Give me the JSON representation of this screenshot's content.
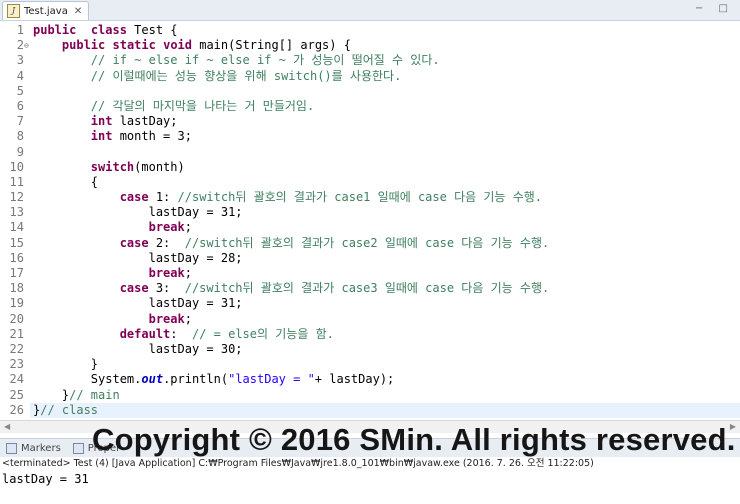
{
  "tab": {
    "label": "Test.java",
    "close": "✕"
  },
  "window_buttons": "− □",
  "code_lines": [
    {
      "n": "1",
      "parts": [
        [
          "kw",
          "public"
        ],
        [
          "",
          "  "
        ],
        [
          "kw",
          "class"
        ],
        [
          "",
          " Test {"
        ]
      ]
    },
    {
      "n": "2",
      "fold": "⊖",
      "parts": [
        [
          "",
          "    "
        ],
        [
          "kw",
          "public"
        ],
        [
          "",
          " "
        ],
        [
          "kw",
          "static"
        ],
        [
          "",
          " "
        ],
        [
          "kw",
          "void"
        ],
        [
          "",
          " main(String[] args) {"
        ]
      ]
    },
    {
      "n": "3",
      "parts": [
        [
          "",
          "        "
        ],
        [
          "cm",
          "// if ~ else if ~ else if ~ 가 성능이 떨어질 수 있다."
        ]
      ]
    },
    {
      "n": "4",
      "parts": [
        [
          "",
          "        "
        ],
        [
          "cm",
          "// 이럴때에는 성능 향상을 위해 switch()를 사용한다."
        ]
      ]
    },
    {
      "n": "5",
      "parts": []
    },
    {
      "n": "6",
      "parts": [
        [
          "",
          "        "
        ],
        [
          "cm",
          "// 각달의 마지막을 나타는 거 만들거임."
        ]
      ]
    },
    {
      "n": "7",
      "parts": [
        [
          "",
          "        "
        ],
        [
          "kw",
          "int"
        ],
        [
          "",
          " lastDay;"
        ]
      ]
    },
    {
      "n": "8",
      "parts": [
        [
          "",
          "        "
        ],
        [
          "kw",
          "int"
        ],
        [
          "",
          " month = 3;"
        ]
      ]
    },
    {
      "n": "9",
      "parts": []
    },
    {
      "n": "10",
      "parts": [
        [
          "",
          "        "
        ],
        [
          "kw",
          "switch"
        ],
        [
          "",
          "(month)"
        ]
      ]
    },
    {
      "n": "11",
      "parts": [
        [
          "",
          "        {"
        ]
      ]
    },
    {
      "n": "12",
      "parts": [
        [
          "",
          "            "
        ],
        [
          "kw",
          "case"
        ],
        [
          "",
          " 1: "
        ],
        [
          "cm",
          "//switch뒤 괄호의 결과가 case1 일때에 case 다음 기능 수행."
        ]
      ]
    },
    {
      "n": "13",
      "parts": [
        [
          "",
          "                lastDay = 31;"
        ]
      ]
    },
    {
      "n": "14",
      "parts": [
        [
          "",
          "                "
        ],
        [
          "kw",
          "break"
        ],
        [
          "",
          ";"
        ]
      ]
    },
    {
      "n": "15",
      "parts": [
        [
          "",
          "            "
        ],
        [
          "kw",
          "case"
        ],
        [
          "",
          " 2:  "
        ],
        [
          "cm",
          "//switch뒤 괄호의 결과가 case2 일때에 case 다음 기능 수행."
        ]
      ]
    },
    {
      "n": "16",
      "parts": [
        [
          "",
          "                lastDay = 28;"
        ]
      ]
    },
    {
      "n": "17",
      "parts": [
        [
          "",
          "                "
        ],
        [
          "kw",
          "break"
        ],
        [
          "",
          ";"
        ]
      ]
    },
    {
      "n": "18",
      "parts": [
        [
          "",
          "            "
        ],
        [
          "kw",
          "case"
        ],
        [
          "",
          " 3:  "
        ],
        [
          "cm",
          "//switch뒤 괄호의 결과가 case3 일때에 case 다음 기능 수행."
        ]
      ]
    },
    {
      "n": "19",
      "parts": [
        [
          "",
          "                lastDay = 31;"
        ]
      ]
    },
    {
      "n": "20",
      "parts": [
        [
          "",
          "                "
        ],
        [
          "kw",
          "break"
        ],
        [
          "",
          ";"
        ]
      ]
    },
    {
      "n": "21",
      "parts": [
        [
          "",
          "            "
        ],
        [
          "kw",
          "default"
        ],
        [
          "",
          ":  "
        ],
        [
          "cm",
          "// = else의 기능을 함."
        ]
      ]
    },
    {
      "n": "22",
      "parts": [
        [
          "",
          "                lastDay = 30;"
        ]
      ]
    },
    {
      "n": "23",
      "parts": [
        [
          "",
          "        }"
        ]
      ]
    },
    {
      "n": "24",
      "parts": [
        [
          "",
          "        System."
        ],
        [
          "fd",
          "out"
        ],
        [
          "",
          ".println("
        ],
        [
          "st",
          "\"lastDay = \""
        ],
        [
          "",
          "+ lastDay);"
        ]
      ]
    },
    {
      "n": "25",
      "parts": [
        [
          "",
          "    }"
        ],
        [
          "cm",
          "// main"
        ]
      ]
    },
    {
      "n": "26",
      "parts": [
        [
          "",
          "}"
        ],
        [
          "cm",
          "// class"
        ]
      ]
    }
  ],
  "highlight_line": 26,
  "console": {
    "tab_markers": "Markers",
    "tab_properties": "Proper",
    "status": "<terminated> Test (4) [Java Application] C:₩Program Files₩Java₩jre1.8.0_101₩bin₩javaw.exe (2016. 7. 26. 오전 11:22:05)",
    "output": "lastDay = 31"
  },
  "watermark": "Copyright © 2016 SMin. All rights reserved."
}
